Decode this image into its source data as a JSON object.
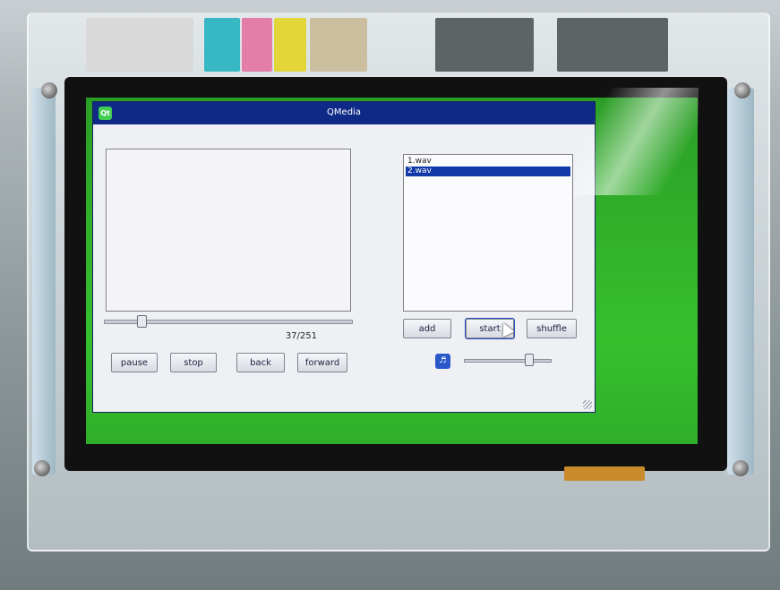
{
  "window": {
    "title": "QMedia",
    "logo_text": "Qt"
  },
  "player": {
    "time_label": "37/251",
    "seek_position": 0.15,
    "buttons": {
      "pause": "pause",
      "stop": "stop",
      "back": "back",
      "forward": "forward"
    }
  },
  "playlist": {
    "items": [
      {
        "label": "1.wav",
        "selected": false
      },
      {
        "label": "2.wav",
        "selected": true
      }
    ]
  },
  "controls": {
    "add": "add",
    "start": "start",
    "shuffle": "shuffle"
  },
  "volume": {
    "level": 0.75,
    "icon": "speaker-icon"
  },
  "colors": {
    "titlebar": "#0f2a86",
    "selection": "#1239a8",
    "screen_background": "#36c02e"
  }
}
